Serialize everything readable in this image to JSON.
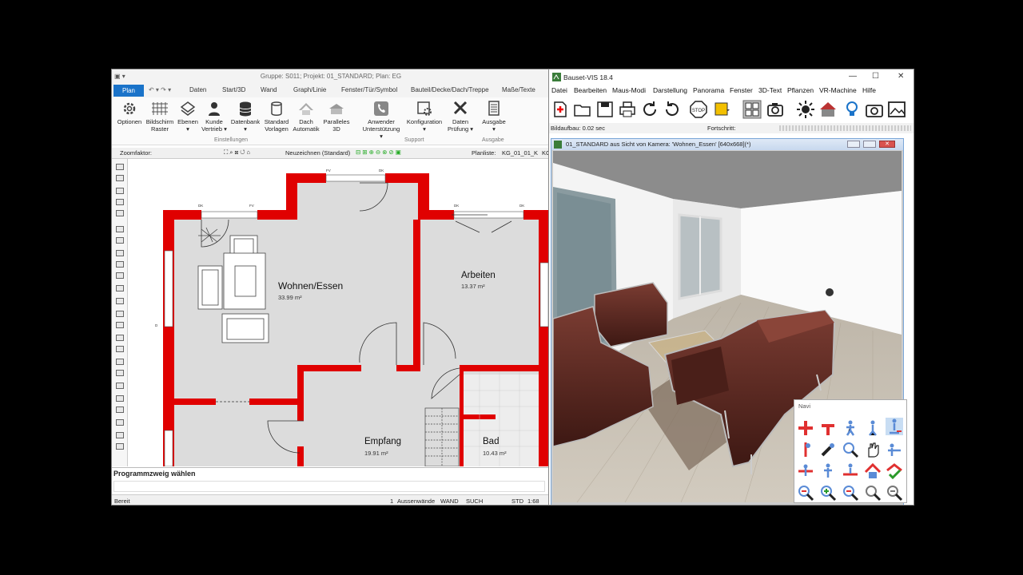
{
  "cad": {
    "title": "Gruppe: S011; Projekt: 01_STANDARD; Plan: EG",
    "tabs": [
      "Plan",
      "Daten",
      "Start/3D",
      "Wand",
      "Graph/Linie",
      "Fenster/Tür/Symbol",
      "Bauteil/Decke/Dach/Treppe",
      "Maße/Texte"
    ],
    "ribbon": [
      {
        "l1": "Optionen",
        "l2": ""
      },
      {
        "l1": "Bildschirm",
        "l2": "Raster"
      },
      {
        "l1": "Ebenen",
        "l2": "▾"
      },
      {
        "l1": "Kunde",
        "l2": "Vertrieb ▾"
      },
      {
        "l1": "Datenbank",
        "l2": "▾"
      },
      {
        "l1": "Standard",
        "l2": "Vorlagen"
      },
      {
        "l1": "Dach",
        "l2": "Automatik"
      },
      {
        "l1": "Paralleles",
        "l2": "3D"
      },
      {
        "l1": "Anwender",
        "l2": "Unterstützung ▾"
      },
      {
        "l1": "Konfiguration",
        "l2": "▾"
      },
      {
        "l1": "Daten",
        "l2": "Prüfung ▾"
      },
      {
        "l1": "Ausgabe",
        "l2": "▾"
      }
    ],
    "groups": {
      "einstellungen": "Einstellungen",
      "support": "Support",
      "ausgabe": "Ausgabe"
    },
    "toolbar": {
      "zoom": "Zoomfaktor:",
      "neuzeichnen": "Neuzeichnen (Standard)",
      "planliste": "Planliste:",
      "planliste_val": "KG_01_01_K",
      "trail": "KG"
    },
    "rooms": [
      {
        "name": "Wohnen/Essen",
        "area": "33.99 m²"
      },
      {
        "name": "Arbeiten",
        "area": "13.37 m²"
      },
      {
        "name": "Empfang",
        "area": "19.91 m²"
      },
      {
        "name": "Bad",
        "area": "10.43 m²"
      }
    ],
    "plan_marks": {
      "fv": "FV",
      "dk": "DK",
      "d": "D"
    },
    "cmd_label": "Programmzweig wählen",
    "status": {
      "left": "Bereit",
      "count": "1",
      "aussen": "Aussenwände",
      "wand": "WAND",
      "such": "SUCH",
      "std": "STD",
      "scale": "1:68"
    }
  },
  "vis": {
    "title": "Bauset-VIS 18.4",
    "menu": [
      "Datei",
      "Bearbeiten",
      "Maus-Modi",
      "Darstellung",
      "Panorama",
      "Fenster",
      "3D-Text",
      "Pflanzen",
      "VR-Machine",
      "Hilfe"
    ],
    "bildaufbau": "Bildaufbau: 0.02 sec",
    "fortschritt": "Fortschritt:",
    "subwindow_title": "01_STANDARD aus Sicht von Kamera: 'Wohnen_Essen' [640x668](*)",
    "toolbar_icons": [
      "new-icon",
      "open-icon",
      "save-icon",
      "print-icon",
      "redo-icon",
      "undo-icon",
      "stop-icon",
      "color-icon",
      "grid-icon",
      "camera-icon",
      "light-icon",
      "house-icon",
      "bulb-icon",
      "photo-icon",
      "image-icon"
    ],
    "navi_title": "Navi"
  },
  "colors": {
    "wall": "#e00000",
    "accent": "#1a73c9",
    "floor": "#d8d8d8",
    "sofa": "#5a2a22"
  }
}
